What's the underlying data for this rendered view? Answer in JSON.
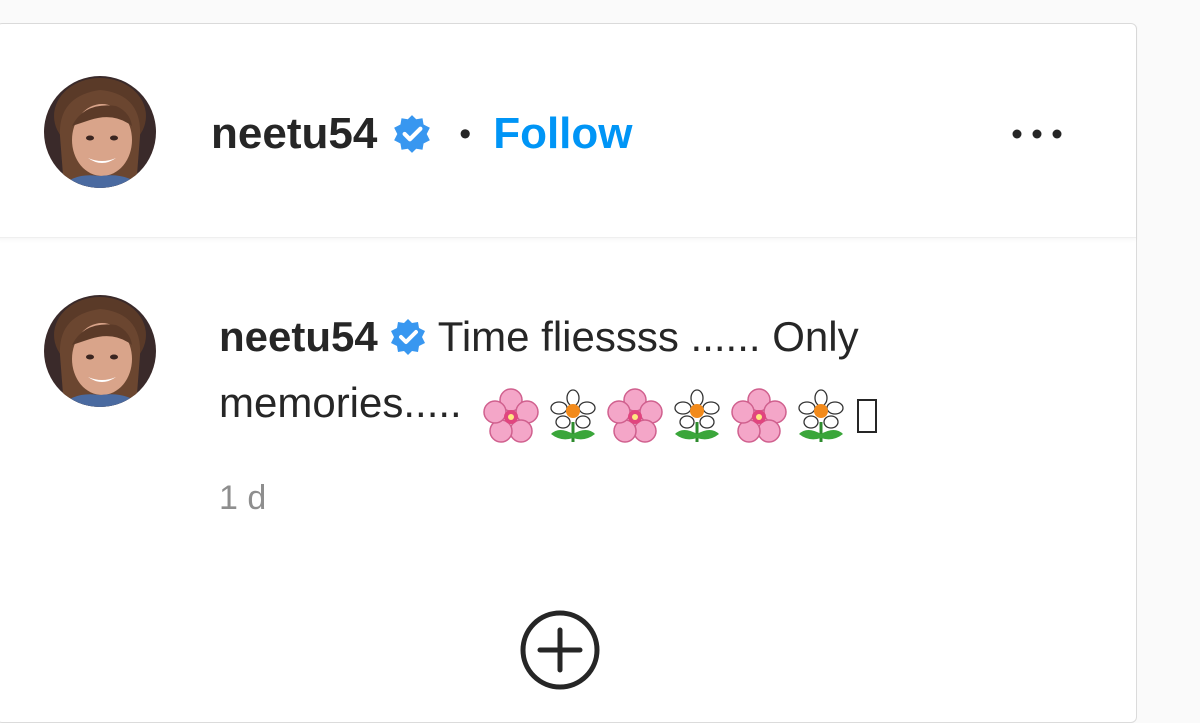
{
  "post_header": {
    "username": "neetu54",
    "separator": "•",
    "follow_label": "Follow",
    "more_icon": "more-horizontal-icon"
  },
  "caption": {
    "username": "neetu54",
    "text": "Time fliessss ...... Only memories.....",
    "emojis": [
      "cherry-blossom",
      "blossom-flower",
      "cherry-blossom",
      "blossom-flower",
      "cherry-blossom",
      "blossom-flower"
    ],
    "timestamp": "1 d"
  },
  "actions": {
    "add_icon": "plus-circle-icon"
  },
  "colors": {
    "accent": "#0095f6",
    "verified": "#3897f0",
    "secondary_text": "#8e8e8e"
  }
}
